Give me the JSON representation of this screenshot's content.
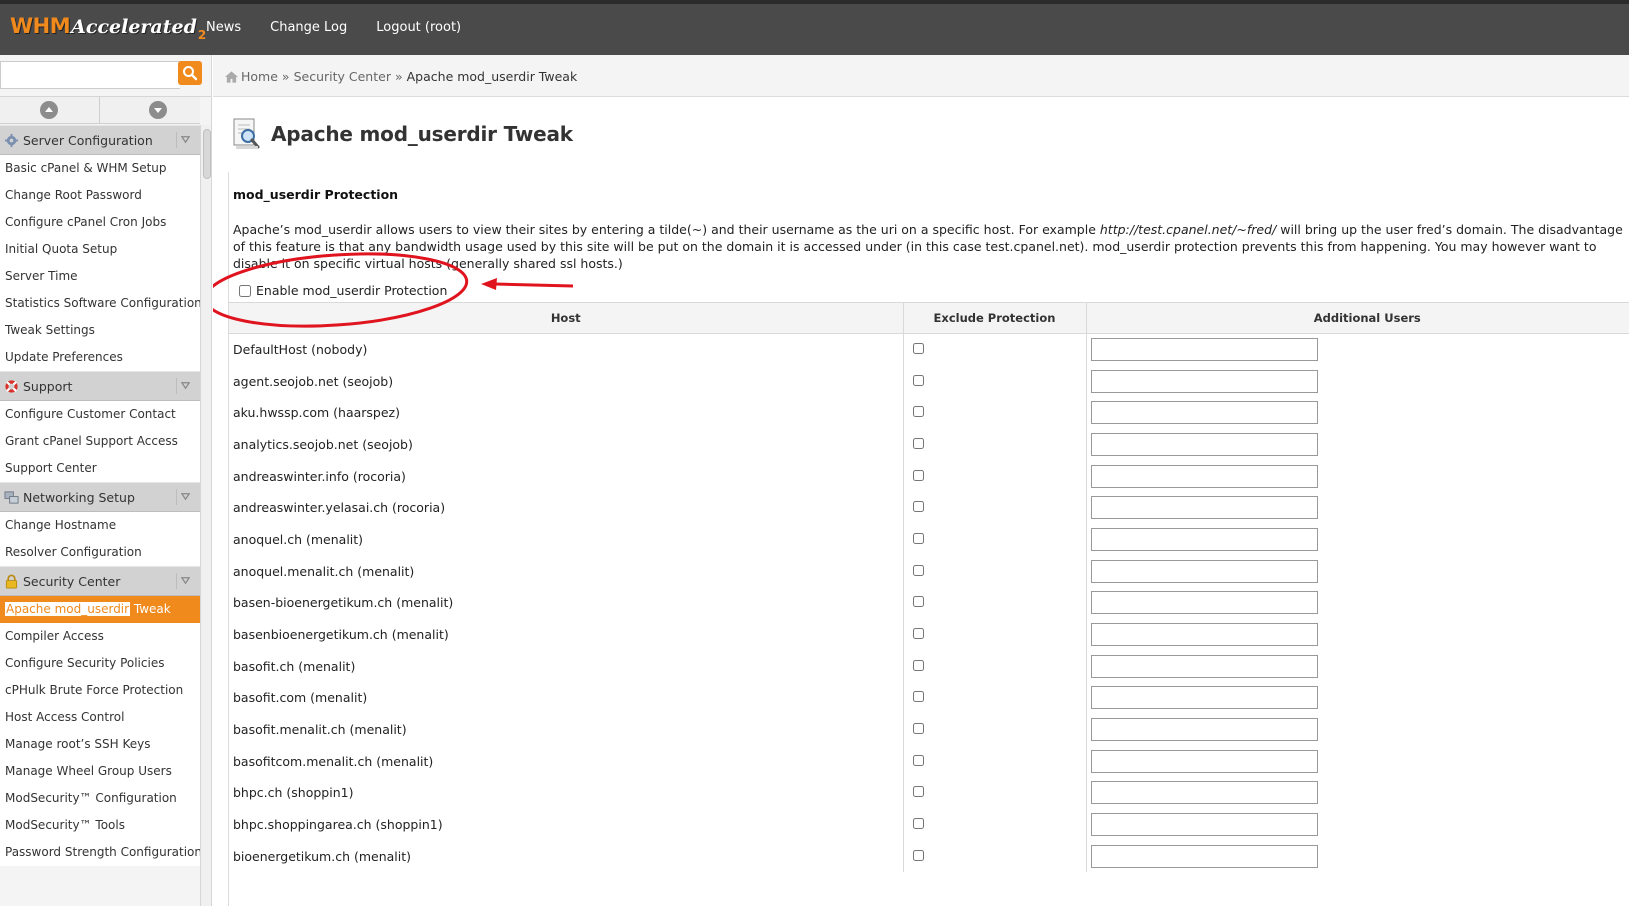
{
  "app": {
    "logo_text_1": "WHM",
    "logo_text_2": "Accelerated",
    "logo_text_3": "2"
  },
  "topnav": [
    "News",
    "Change Log",
    "Logout (root)"
  ],
  "search": {
    "placeholder": ""
  },
  "sidebar": {
    "groups": [
      {
        "title": "Server Configuration",
        "icon": "gear-icon",
        "items": [
          "Basic cPanel & WHM Setup",
          "Change Root Password",
          "Configure cPanel Cron Jobs",
          "Initial Quota Setup",
          "Server Time",
          "Statistics Software Configuration",
          "Tweak Settings",
          "Update Preferences"
        ]
      },
      {
        "title": "Support",
        "icon": "lifebuoy-icon",
        "items": [
          "Configure Customer Contact",
          "Grant cPanel Support Access",
          "Support Center"
        ]
      },
      {
        "title": "Networking Setup",
        "icon": "network-icon",
        "items": [
          "Change Hostname",
          "Resolver Configuration"
        ]
      },
      {
        "title": "Security Center",
        "icon": "lock-icon",
        "active_item": {
          "highlight": "Apache mod_userdir",
          "rest": " Tweak"
        },
        "items": [
          "Compiler Access",
          "Configure Security Policies",
          "cPHulk Brute Force Protection",
          "Host Access Control",
          "Manage root’s SSH Keys",
          "Manage Wheel Group Users",
          "ModSecurity™ Configuration",
          "ModSecurity™ Tools",
          "Password Strength Configuration"
        ]
      }
    ]
  },
  "breadcrumb": {
    "home": "Home",
    "sep": "»",
    "parent": "Security Center",
    "current": "Apache mod_userdir Tweak"
  },
  "page": {
    "title": "Apache mod_userdir Tweak",
    "section_title": "mod_userdir Protection",
    "desc_part1": "Apache’s mod_userdir allows users to view their sites by entering a tilde(~) and their username as the uri on a specific host. For example ",
    "desc_example": "http://test.cpanel.net/~fred/",
    "desc_part2": " will bring up the user fred’s domain. The disadvantage of this feature is that any bandwidth usage used by this site will be put on the domain it is accessed under (in this case test.cpanel.net). mod_userdir protection prevents this from happening. You may however want to disable it on specific virtual hosts (generally shared ssl hosts.)",
    "enable_label": "Enable mod_userdir Protection"
  },
  "table": {
    "headers": [
      "Host",
      "Exclude Protection",
      "Additional Users"
    ],
    "rows": [
      "DefaultHost (nobody)",
      "agent.seojob.net (seojob)",
      "aku.hwssp.com (haarspez)",
      "analytics.seojob.net (seojob)",
      "andreaswinter.info (rocoria)",
      "andreaswinter.yelasai.ch (rocoria)",
      "anoquel.ch (menalit)",
      "anoquel.menalit.ch (menalit)",
      "basen-bioenergetikum.ch (menalit)",
      "basenbioenergetikum.ch (menalit)",
      "basofit.ch (menalit)",
      "basofit.com (menalit)",
      "basofit.menalit.ch (menalit)",
      "basofitcom.menalit.ch (menalit)",
      "bhpc.ch (shoppin1)",
      "bhpc.shoppingarea.ch (shoppin1)",
      "bioenergetikum.ch (menalit)"
    ]
  },
  "colors": {
    "topbar": "#4a4a4a",
    "accent": "#f08a1c",
    "annotation": "#e0141e"
  }
}
